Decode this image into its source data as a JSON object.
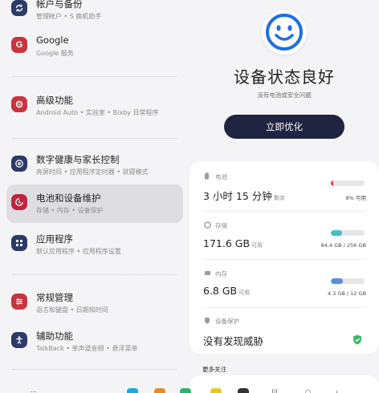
{
  "sidebar": {
    "items": [
      {
        "title": "帐户与备份",
        "sub": "管理帐户 • S 换机助手"
      },
      {
        "title": "Google",
        "sub": "Google 服务"
      },
      {
        "title": "高级功能",
        "sub": "Android Auto • 实验室 • Bixby 日常程序"
      },
      {
        "title": "数字健康与家长控制",
        "sub": "亮屏时间 • 应用程序定时器 • 就寝模式"
      },
      {
        "title": "电池和设备维护",
        "sub": "存储 • 内存 • 设备保护"
      },
      {
        "title": "应用程序",
        "sub": "默认应用程序 • 应用程序设置"
      },
      {
        "title": "常规管理",
        "sub": "语言和键盘 • 日期和时间"
      },
      {
        "title": "辅助功能",
        "sub": "TalkBack • 单声道音频 • 悬浮菜单"
      }
    ]
  },
  "status": {
    "title": "设备状态良好",
    "subtitle": "没有电池或安全问题",
    "optimize_label": "立即优化"
  },
  "battery": {
    "label": "电池",
    "value": "3 小时 15 分钟",
    "suffix": "剩余",
    "note": "8% 可用",
    "level": 0.08,
    "color": "#e0414f"
  },
  "storage": {
    "label": "存储",
    "value": "171.6 GB",
    "suffix": "可用",
    "note": "84.4 GB / 256 GB",
    "level": 0.33,
    "color": "#3fc0c5"
  },
  "memory": {
    "label": "内存",
    "value": "6.8 GB",
    "suffix": "可用",
    "note": "4.3 GB / 12 GB",
    "level": 0.36,
    "color": "#5b8fdc"
  },
  "protection": {
    "label": "设备保护",
    "value": "没有发现威胁"
  },
  "more": {
    "label": "更多关注"
  }
}
